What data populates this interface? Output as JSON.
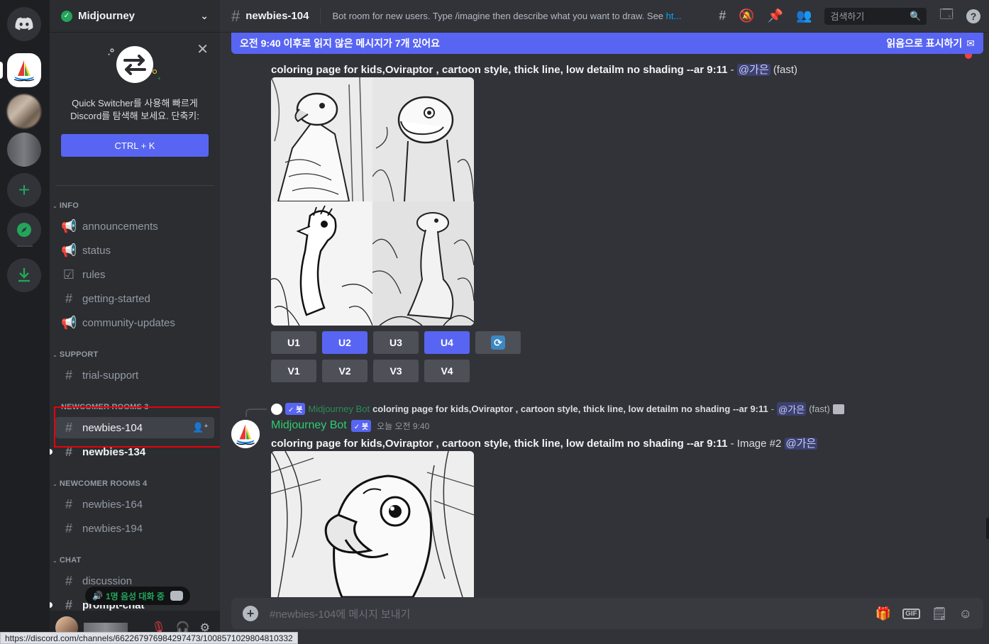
{
  "guild": {
    "name": "Midjourney"
  },
  "quick_switcher": {
    "text": "Quick Switcher를 사용해 빠르게 Discord를 탐색해 보세요. 단축키:",
    "shortcut": "CTRL + K"
  },
  "categories": {
    "info": "INFO",
    "support": "SUPPORT",
    "newcomer3": "NEWCOMER ROOMS 3",
    "newcomer4": "NEWCOMER ROOMS 4",
    "chat": "CHAT"
  },
  "channels": {
    "announcements": "announcements",
    "status": "status",
    "rules": "rules",
    "getting_started": "getting-started",
    "community_updates": "community-updates",
    "trial_support": "trial-support",
    "newbies_104": "newbies-104",
    "newbies_134": "newbies-134",
    "newbies_164": "newbies-164",
    "newbies_194": "newbies-194",
    "discussion": "discussion",
    "prompt_chat": "prompt-chat"
  },
  "voice_pill": "1명 음성 대화 중",
  "status_url": "https://discord.com/channels/662267976984297473/1008571029804810332",
  "header": {
    "channel": "newbies-104",
    "topic": "Bot room for new users. Type /imagine then describe what you want to draw. See ",
    "topic_link": "ht...",
    "search_placeholder": "검색하기"
  },
  "new_messages_bar": {
    "text": "오전 9:40 이후로 읽지 않은 메시지가 7개 있어요",
    "mark_read": "읽음으로 표시하기"
  },
  "message1": {
    "prompt": "coloring page for kids,Oviraptor , cartoon style, thick line, low detailm no shading --ar 9:11",
    "dash": " - ",
    "mention": "@가은",
    "speed": "(fast)",
    "buttons_upscale": [
      "U1",
      "U2",
      "U3",
      "U4"
    ],
    "buttons_variation": [
      "V1",
      "V2",
      "V3",
      "V4"
    ]
  },
  "message2": {
    "reply_bot": "Midjourney Bot",
    "reply_badge": "✓ 봇",
    "reply_prompt": "coloring page for kids,Oviraptor , cartoon style, thick line, low detailm no shading --ar 9:11",
    "reply_dash": " - ",
    "reply_mention": "@가은",
    "reply_speed": "(fast)",
    "author": "Midjourney Bot",
    "badge": "✓ 봇",
    "time": "오늘 오전 9:40",
    "prompt": "coloring page for kids,Oviraptor , cartoon style, thick line, low detailm no shading --ar 9:11",
    "suffix": " - Image #2 ",
    "mention": "@가은"
  },
  "composer": {
    "placeholder": "#newbies-104에 메시지 보내기"
  },
  "colors": {
    "blurple": "#5865f2",
    "bot_green": "#2ecc71",
    "red_highlight": "#e8000b",
    "online": "#23a55a"
  }
}
